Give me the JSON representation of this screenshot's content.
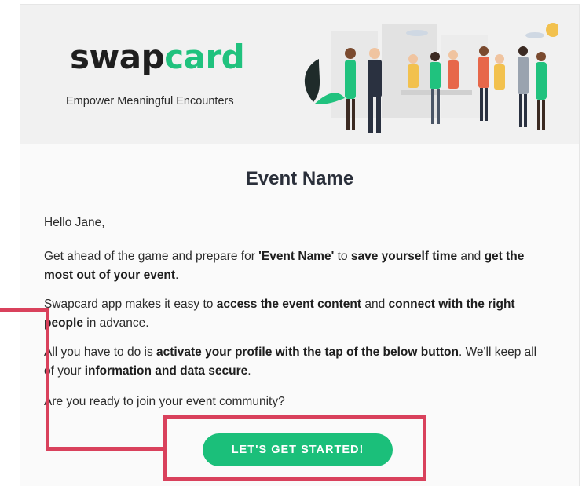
{
  "header": {
    "logo_part1": "swap",
    "logo_part2": "card",
    "tagline": "Empower Meaningful Encounters"
  },
  "email": {
    "title": "Event Name",
    "greeting": "Hello Jane,",
    "p2": {
      "t1": "Get ahead of the game and prepare for ",
      "b1": "'Event Name'",
      "t2": " to ",
      "b2": "save yourself time",
      "t3": " and ",
      "b3": "get the most out of your event",
      "t4": "."
    },
    "p3": {
      "t1": "Swapcard app makes it easy to ",
      "b1": "access the event content",
      "t2": " and ",
      "b2": "connect with the right people",
      "t3": " in advance."
    },
    "p4": {
      "t1": "All you have to do is ",
      "b1": "activate your profile with the tap of the below button",
      "t2": ". We'll keep all of your ",
      "b2": "information and data secure",
      "t3": "."
    },
    "question": "Are you ready to join your event community?",
    "cta_label": "LET'S GET STARTED!"
  },
  "colors": {
    "brand_green": "#1bbf7a",
    "annotation_red": "#d9415c"
  },
  "icons": [
    "people-networking-illustration"
  ]
}
